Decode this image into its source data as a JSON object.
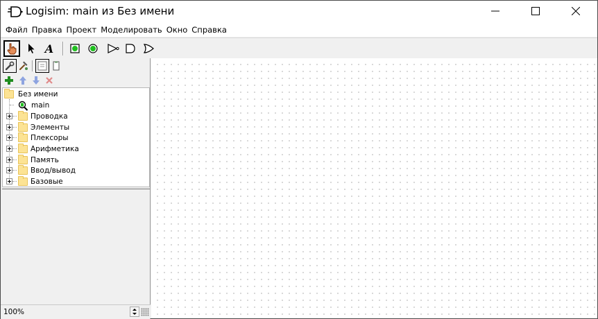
{
  "window": {
    "title": "Logisim: main из Без имени"
  },
  "menu": [
    "Файл",
    "Правка",
    "Проект",
    "Моделировать",
    "Окно",
    "Справка"
  ],
  "toolbar": {
    "tools": [
      {
        "name": "poke-tool-icon",
        "selected": true
      },
      {
        "name": "select-tool-icon",
        "selected": false
      },
      {
        "name": "text-tool-icon",
        "selected": false
      },
      {
        "name": "input-pin-icon",
        "selected": false
      },
      {
        "name": "output-pin-icon",
        "selected": false
      },
      {
        "name": "not-gate-icon",
        "selected": false
      },
      {
        "name": "and-gate-icon",
        "selected": false
      },
      {
        "name": "or-gate-icon",
        "selected": false
      }
    ],
    "text_tool_glyph": "A"
  },
  "explorer": {
    "tree": {
      "root": "Без имени",
      "circuit": "main",
      "libraries": [
        "Проводка",
        "Элементы",
        "Плексоры",
        "Арифметика",
        "Память",
        "Ввод/вывод",
        "Базовые"
      ]
    }
  },
  "status": {
    "zoom": "100%"
  },
  "colors": {
    "folder": "#fce394",
    "add_green": "#1e8c1e",
    "arrow_blue": "#8ea4e0",
    "delete_red": "#e08a8a",
    "pin_green": "#1fbf1f"
  }
}
